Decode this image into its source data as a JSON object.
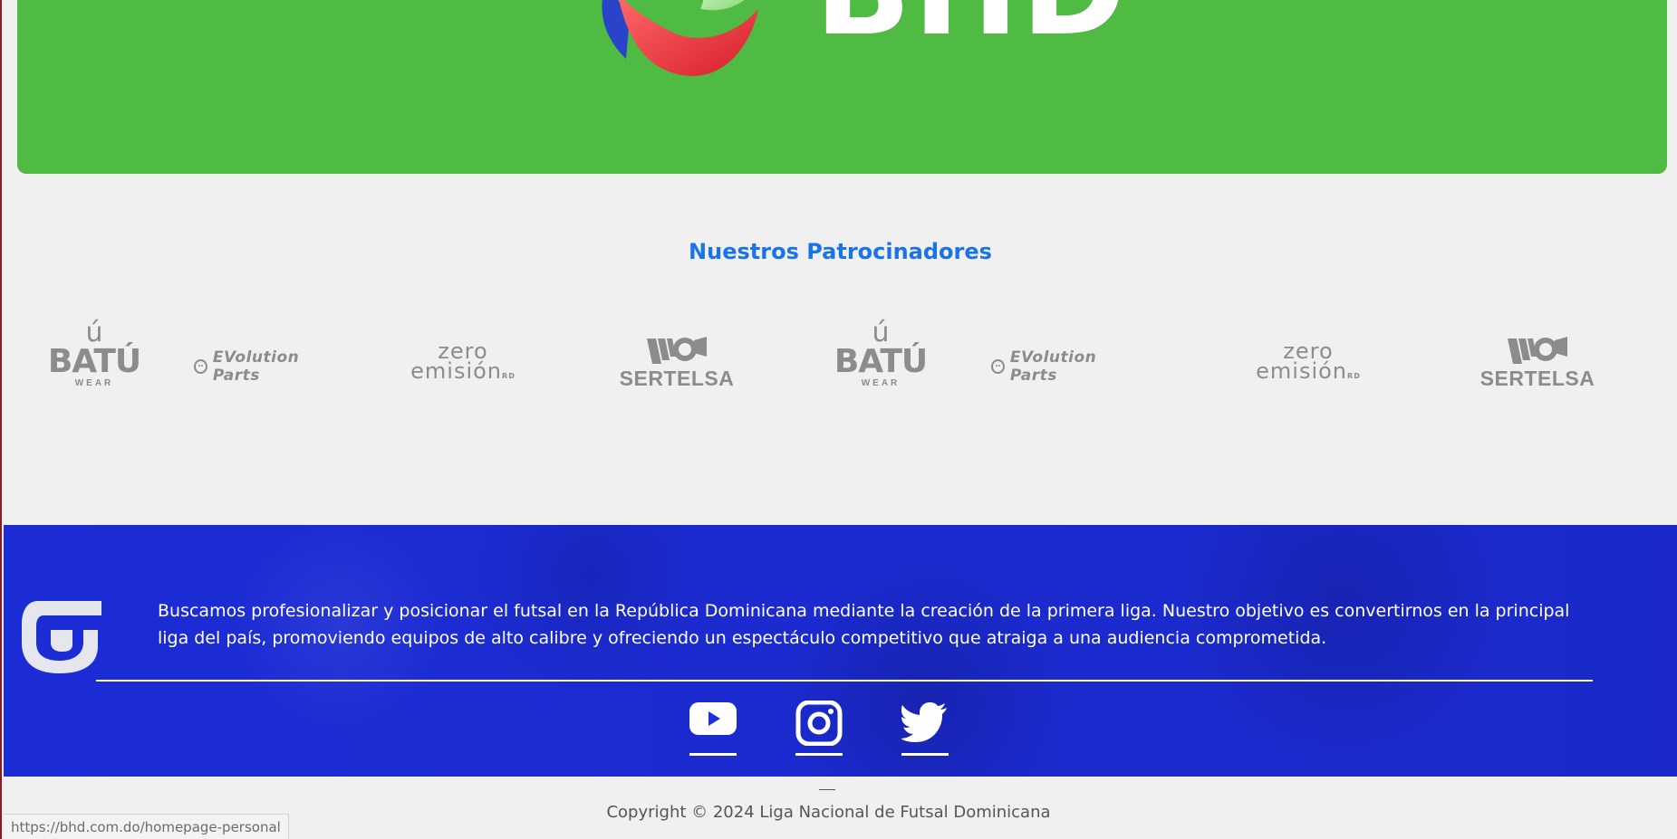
{
  "banner": {
    "brand_text": "BHD",
    "background_color": "#4fbb43"
  },
  "sponsors": {
    "title": "Nuestros Patrocinadores",
    "title_color": "#1a73e8",
    "logos": [
      {
        "name": "BATÚ",
        "sub": "WEAR"
      },
      {
        "name": "EVolution Parts"
      },
      {
        "line1": "zero",
        "line2": "emisión",
        "suffix": "RD"
      },
      {
        "name": "SERTELSA"
      },
      {
        "name": "BATÚ",
        "sub": "WEAR"
      },
      {
        "name": "EVolution Parts"
      },
      {
        "line1": "zero",
        "line2": "emisión",
        "suffix": "RD"
      },
      {
        "name": "SERTELSA"
      }
    ]
  },
  "footer": {
    "background_color": "#1e2fe0",
    "description": "Buscamos profesionalizar y posicionar el futsal en la República Dominicana mediante la creación de la primera liga. Nuestro objetivo es convertirnos en la principal liga del país, promoviendo equipos de alto calibre y ofreciendo un espectáculo competitivo que atraiga a una audiencia comprometida.",
    "social": [
      {
        "icon": "youtube-icon"
      },
      {
        "icon": "instagram-icon"
      },
      {
        "icon": "twitter-icon"
      }
    ]
  },
  "copyright": "Copyright © 2024 Liga Nacional de Futsal Dominicana",
  "status_bar": {
    "url": "https://bhd.com.do/homepage-personal"
  }
}
